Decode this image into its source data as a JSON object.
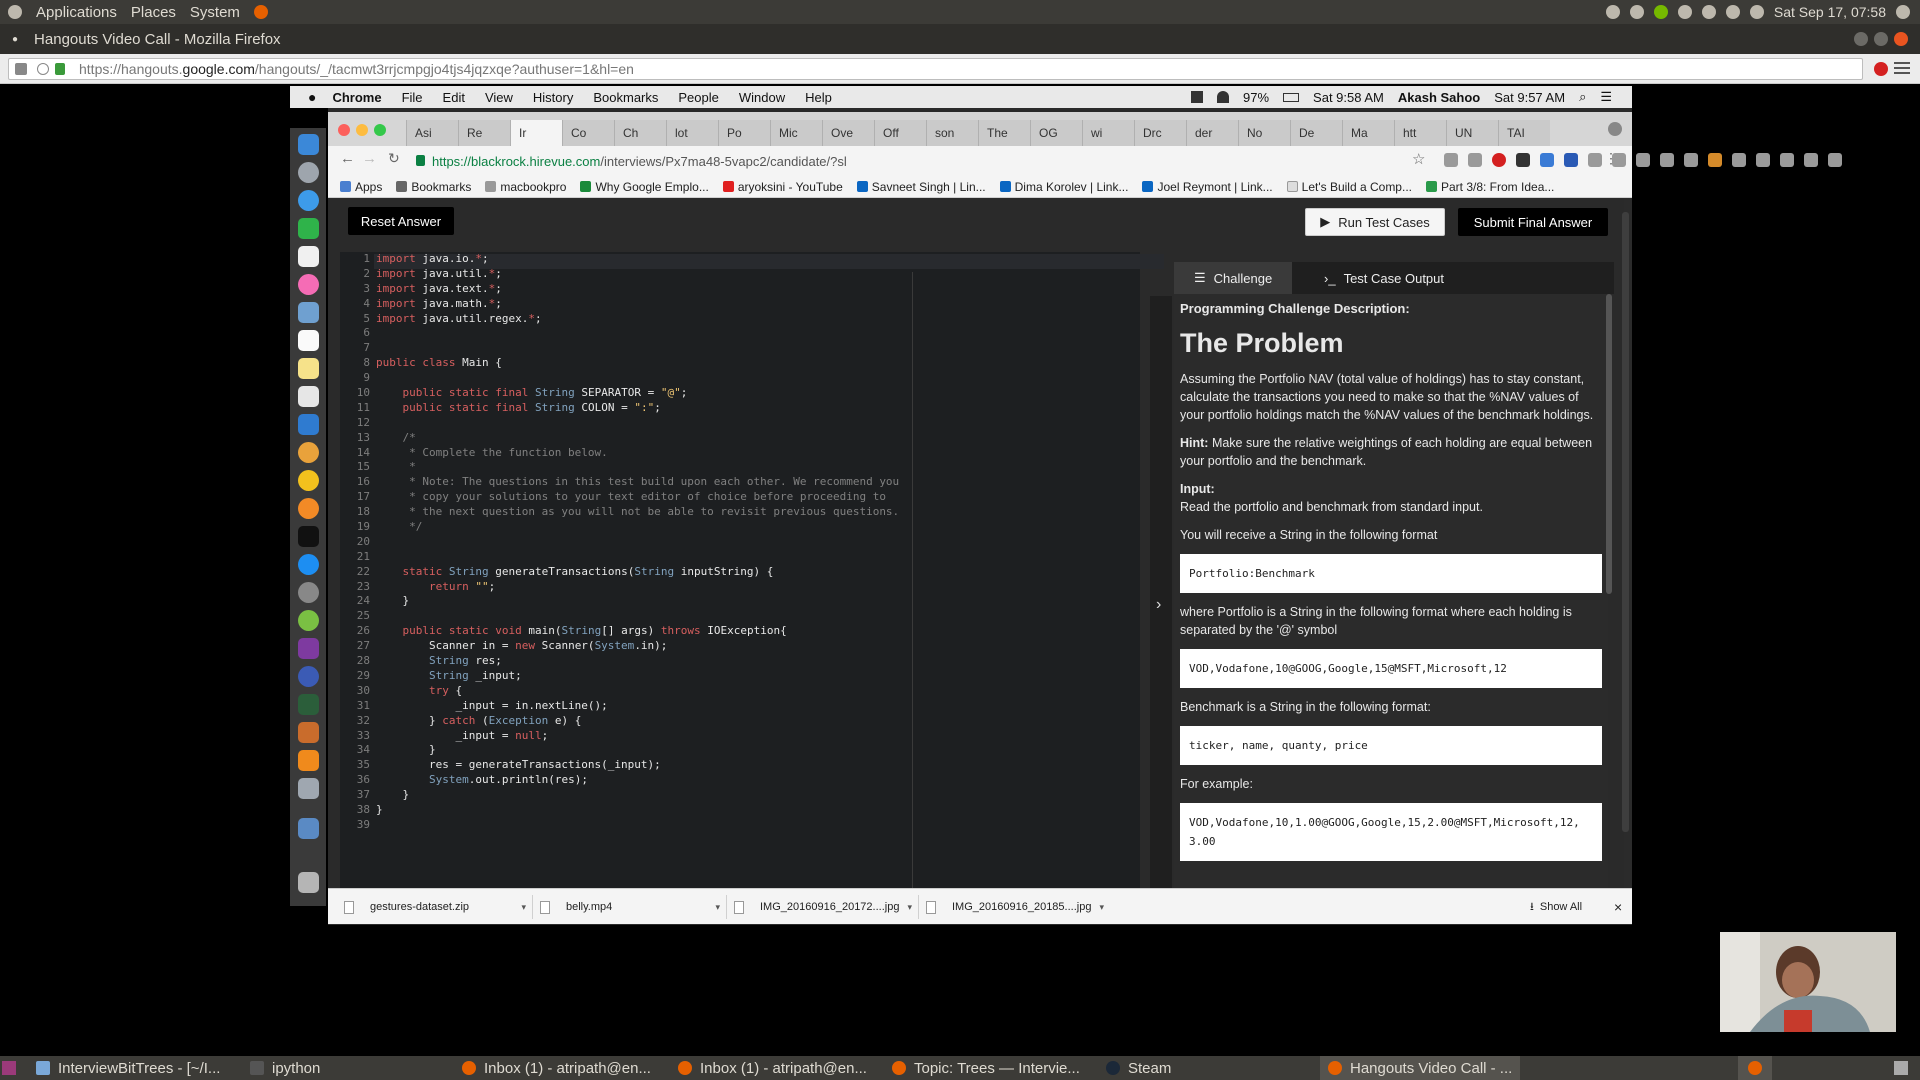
{
  "ubuntu_panel": {
    "menus": [
      "Applications",
      "Places",
      "System"
    ],
    "clock": "Sat Sep 17, 07:58"
  },
  "firefox": {
    "window_title": "Hangouts Video Call - Mozilla Firefox",
    "url_prefix": "https://hangouts.",
    "url_domain": "google.com",
    "url_path": "/hangouts/_/tacmwt3rrjcmpgjo4tjs4jqzxqe?authuser=1&hl=en"
  },
  "mac": {
    "menu": [
      "Chrome",
      "File",
      "Edit",
      "View",
      "History",
      "Bookmarks",
      "People",
      "Window",
      "Help"
    ],
    "battery": "97%",
    "time1": "Sat 9:58 AM",
    "user": "Akash Sahoo",
    "time2": "Sat 9:57 AM"
  },
  "chrome": {
    "tabs": [
      "Asi",
      "Re",
      "Ir",
      "Co",
      "Ch",
      "lot",
      "Po",
      "Mic",
      "Ove",
      "Off",
      "son",
      "The",
      "OG",
      "wi",
      "Drc",
      "der",
      "No",
      "De",
      "Ma",
      "htt",
      "UN",
      "TAI"
    ],
    "url_domain": "https://blackrock.hirevue.com",
    "url_path": "/interviews/Px7ma48-5vapc2/candidate/?sl",
    "bookmarks": [
      "Apps",
      "Bookmarks",
      "macbookpro",
      "Why Google Emplo...",
      "aryoksini - YouTube",
      "Savneet Singh | Lin...",
      "Dima Korolev | Link...",
      "Joel Reymont | Link...",
      "Let's Build a Comp...",
      "Part 3/8: From Idea..."
    ]
  },
  "hirevue": {
    "reset_label": "Reset Answer",
    "run_label": "Run Test Cases",
    "submit_label": "Submit Final Answer",
    "tab_challenge": "Challenge",
    "tab_output": "Test Case Output",
    "heading": "Programming Challenge Description:",
    "title": "The Problem",
    "p1": "Assuming the Portfolio NAV (total value of holdings) has to stay constant, calculate the transactions you need to make so that the %NAV values of your portfolio holdings match the %NAV values of the benchmark holdings.",
    "hint_label": "Hint:",
    "hint_text": " Make sure the relative weightings of each holding are equal between your portfolio and the benchmark.",
    "input_label": "Input:",
    "input_text": "Read the portfolio and benchmark from standard input.",
    "p_format": "You will receive a String in the following format",
    "code1": "Portfolio:Benchmark",
    "p_portfolio": "where Portfolio is a String in the following format where each holding is separated by the '@' symbol",
    "code2": "VOD,Vodafone,10@GOOG,Google,15@MSFT,Microsoft,12",
    "p_benchmark": "Benchmark is a String in the following format:",
    "code3": "ticker, name, quanty, price",
    "p_example": "For example:",
    "code4": "VOD,Vodafone,10,1.00@GOOG,Google,15,2.00@MSFT,Microsoft,12, 3.00"
  },
  "downloads": {
    "files": [
      "gestures-dataset.zip",
      "belly.mp4",
      "IMG_20160916_20172....jpg",
      "IMG_20160916_20185....jpg"
    ],
    "show_all": "Show All"
  },
  "taskbar": {
    "items": [
      "InterviewBitTrees - [~/I...",
      "ipython",
      "Inbox (1) - atripath@en...",
      "Inbox (1) - atripath@en...",
      "Topic: Trees — Intervie...",
      "Steam",
      "Hangouts Video Call - ..."
    ]
  }
}
